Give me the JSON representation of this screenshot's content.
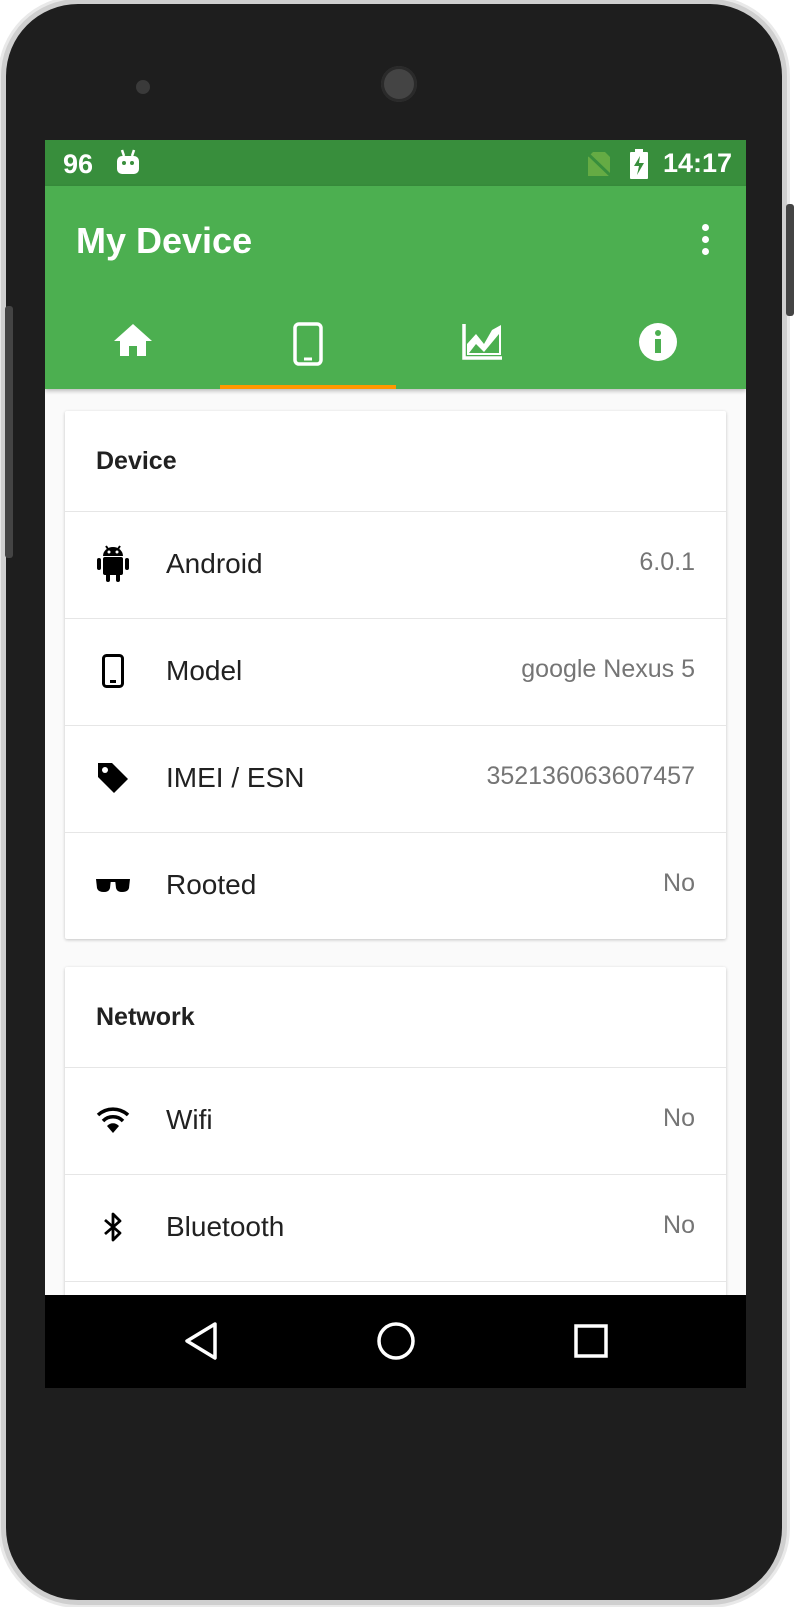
{
  "status_bar": {
    "left_text": "96",
    "time": "14:17",
    "icons": [
      "android-robot-icon",
      "no-sim-icon",
      "battery-charging-icon"
    ]
  },
  "app": {
    "title": "My Device",
    "colors": {
      "status": "#388e3c",
      "primary": "#4caf50",
      "accent": "#ff9800"
    }
  },
  "tabs": [
    {
      "icon": "home-icon",
      "active": false
    },
    {
      "icon": "smartphone-icon",
      "active": true
    },
    {
      "icon": "chart-icon",
      "active": false
    },
    {
      "icon": "info-icon",
      "active": false
    }
  ],
  "device_card": {
    "title": "Device",
    "rows": [
      {
        "icon": "android-icon",
        "label": "Android",
        "value": "6.0.1"
      },
      {
        "icon": "phone-icon",
        "label": "Model",
        "value": "google Nexus 5"
      },
      {
        "icon": "tag-icon",
        "label": "IMEI / ESN",
        "value": "352136063607457"
      },
      {
        "icon": "sunglasses-icon",
        "label": "Rooted",
        "value": "No"
      }
    ]
  },
  "network_card": {
    "title": "Network",
    "rows": [
      {
        "icon": "wifi-icon",
        "label": "Wifi",
        "value": "No"
      },
      {
        "icon": "bluetooth-icon",
        "label": "Bluetooth",
        "value": "No"
      }
    ]
  },
  "nav_bar": {
    "buttons": [
      "back-icon",
      "home-circle-icon",
      "recents-icon"
    ]
  }
}
